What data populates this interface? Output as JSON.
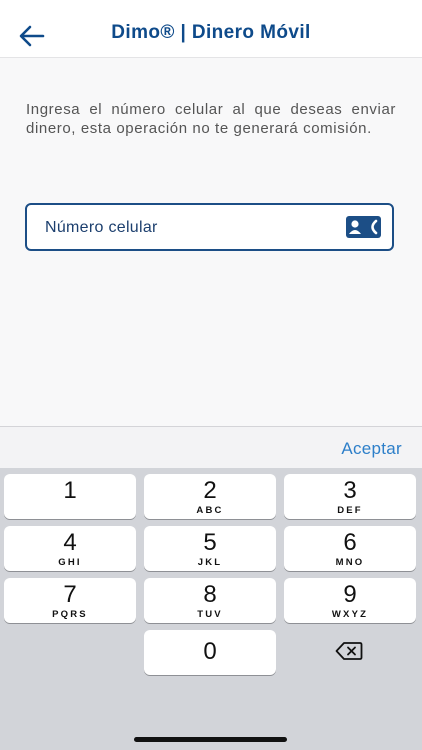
{
  "header": {
    "title": "Dimo® | Dinero Móvil"
  },
  "instructions": "Ingresa el número celular al que deseas enviar dinero, esta operación no te generará comisión.",
  "phone_field": {
    "placeholder": "Número celular"
  },
  "keyboard": {
    "accept_label": "Aceptar",
    "keys": [
      {
        "num": "1",
        "letters": ""
      },
      {
        "num": "2",
        "letters": "ABC"
      },
      {
        "num": "3",
        "letters": "DEF"
      },
      {
        "num": "4",
        "letters": "GHI"
      },
      {
        "num": "5",
        "letters": "JKL"
      },
      {
        "num": "6",
        "letters": "MNO"
      },
      {
        "num": "7",
        "letters": "PQRS"
      },
      {
        "num": "8",
        "letters": "TUV"
      },
      {
        "num": "9",
        "letters": "WXYZ"
      },
      {
        "num": "0",
        "letters": ""
      }
    ]
  },
  "icons": {
    "back": "back-arrow-icon",
    "contact": "contact-card-icon",
    "delete": "backspace-icon"
  },
  "colors": {
    "brand": "#0e4a8a",
    "field_border": "#1c4e86",
    "accept": "#2d7fc9"
  }
}
